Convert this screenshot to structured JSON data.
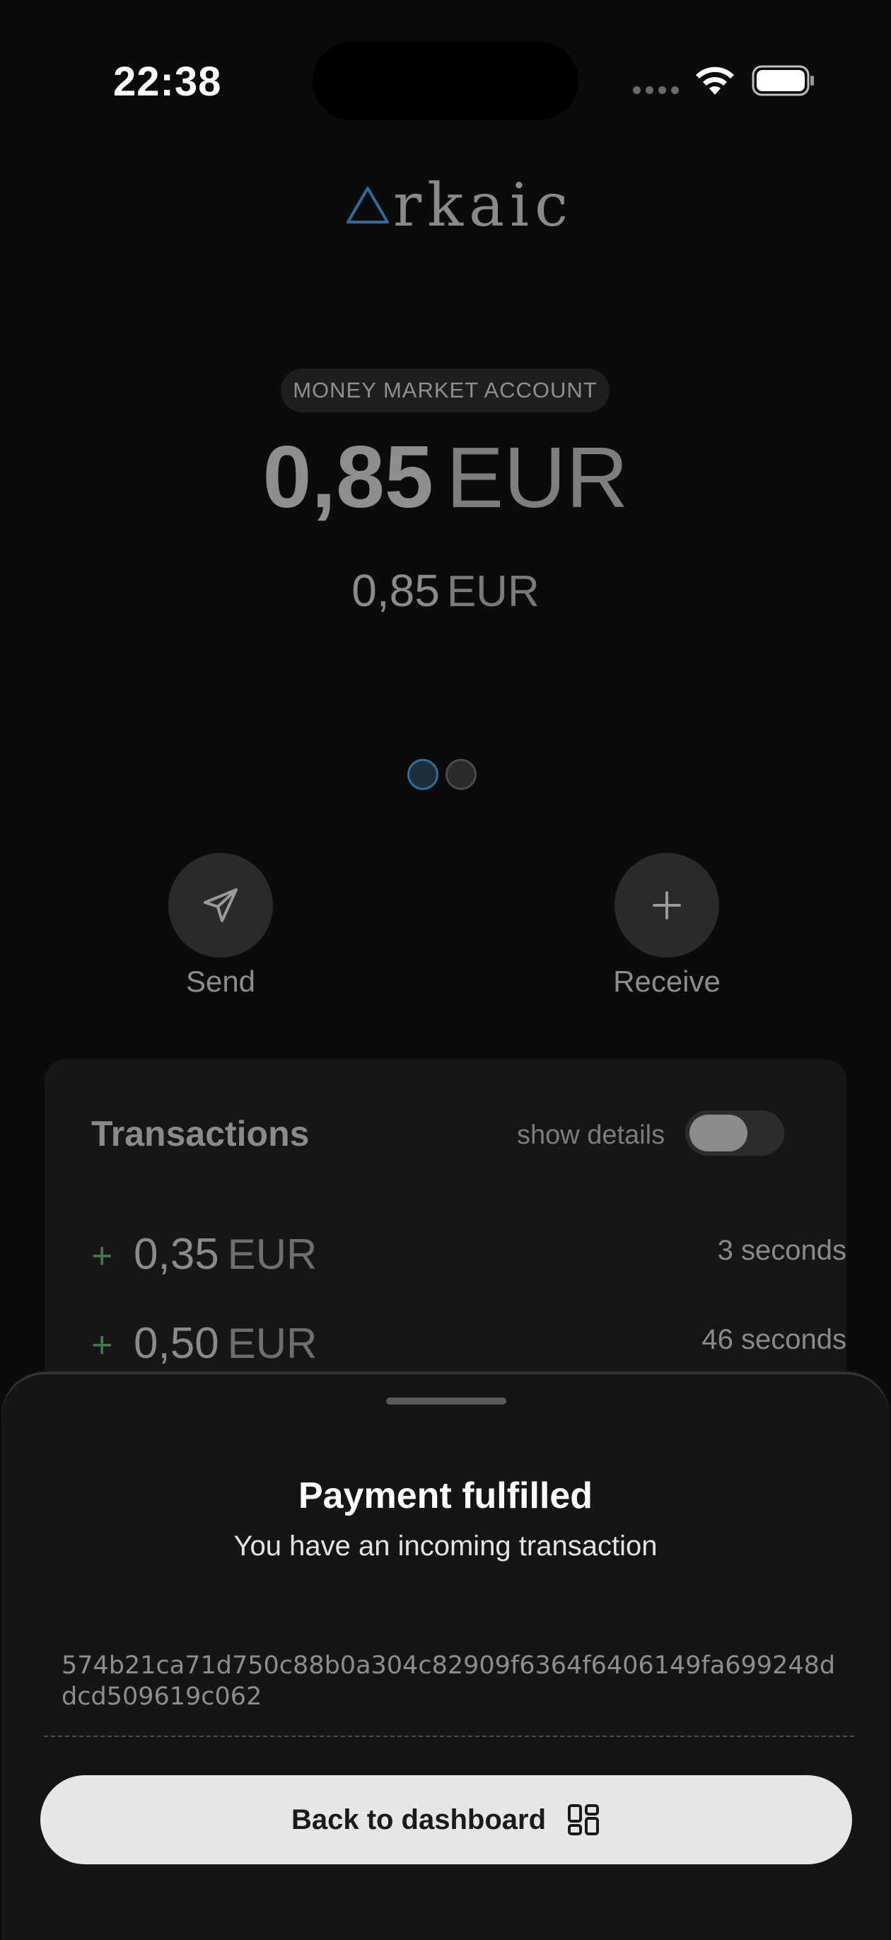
{
  "status_bar": {
    "time": "22:38"
  },
  "logo": {
    "text": "rkaic"
  },
  "account": {
    "type_label": "MONEY MARKET ACCOUNT",
    "balance_amount": "0,85",
    "balance_currency": "EUR",
    "secondary_amount": "0,85",
    "secondary_currency": "EUR"
  },
  "pager": {
    "pages": 2,
    "active_index": 0
  },
  "actions": {
    "send_label": "Send",
    "receive_label": "Receive"
  },
  "transactions": {
    "title": "Transactions",
    "show_details_label": "show details",
    "show_details_on": false,
    "items": [
      {
        "sign": "+",
        "amount": "0,35",
        "currency": "EUR",
        "ago": "3 seconds"
      },
      {
        "sign": "+",
        "amount": "0,50",
        "currency": "EUR",
        "ago": "46 seconds"
      }
    ]
  },
  "sheet": {
    "title": "Payment fulfilled",
    "subtitle": "You have an incoming transaction",
    "hash": "574b21ca71d750c88b0a304c82909f6364f6406149fa699248ddcd509619c062",
    "button_label": "Back to dashboard"
  },
  "colors": {
    "background": "#0b0b0b",
    "accent_blue": "#2e6f9b",
    "positive_green": "#3f7a4a",
    "button_bg": "#e6e6e6"
  },
  "icons": {
    "send": "paper-plane-icon",
    "receive": "plus-icon",
    "dashboard": "dashboard-grid-icon",
    "wifi": "wifi-icon",
    "battery": "battery-icon"
  }
}
